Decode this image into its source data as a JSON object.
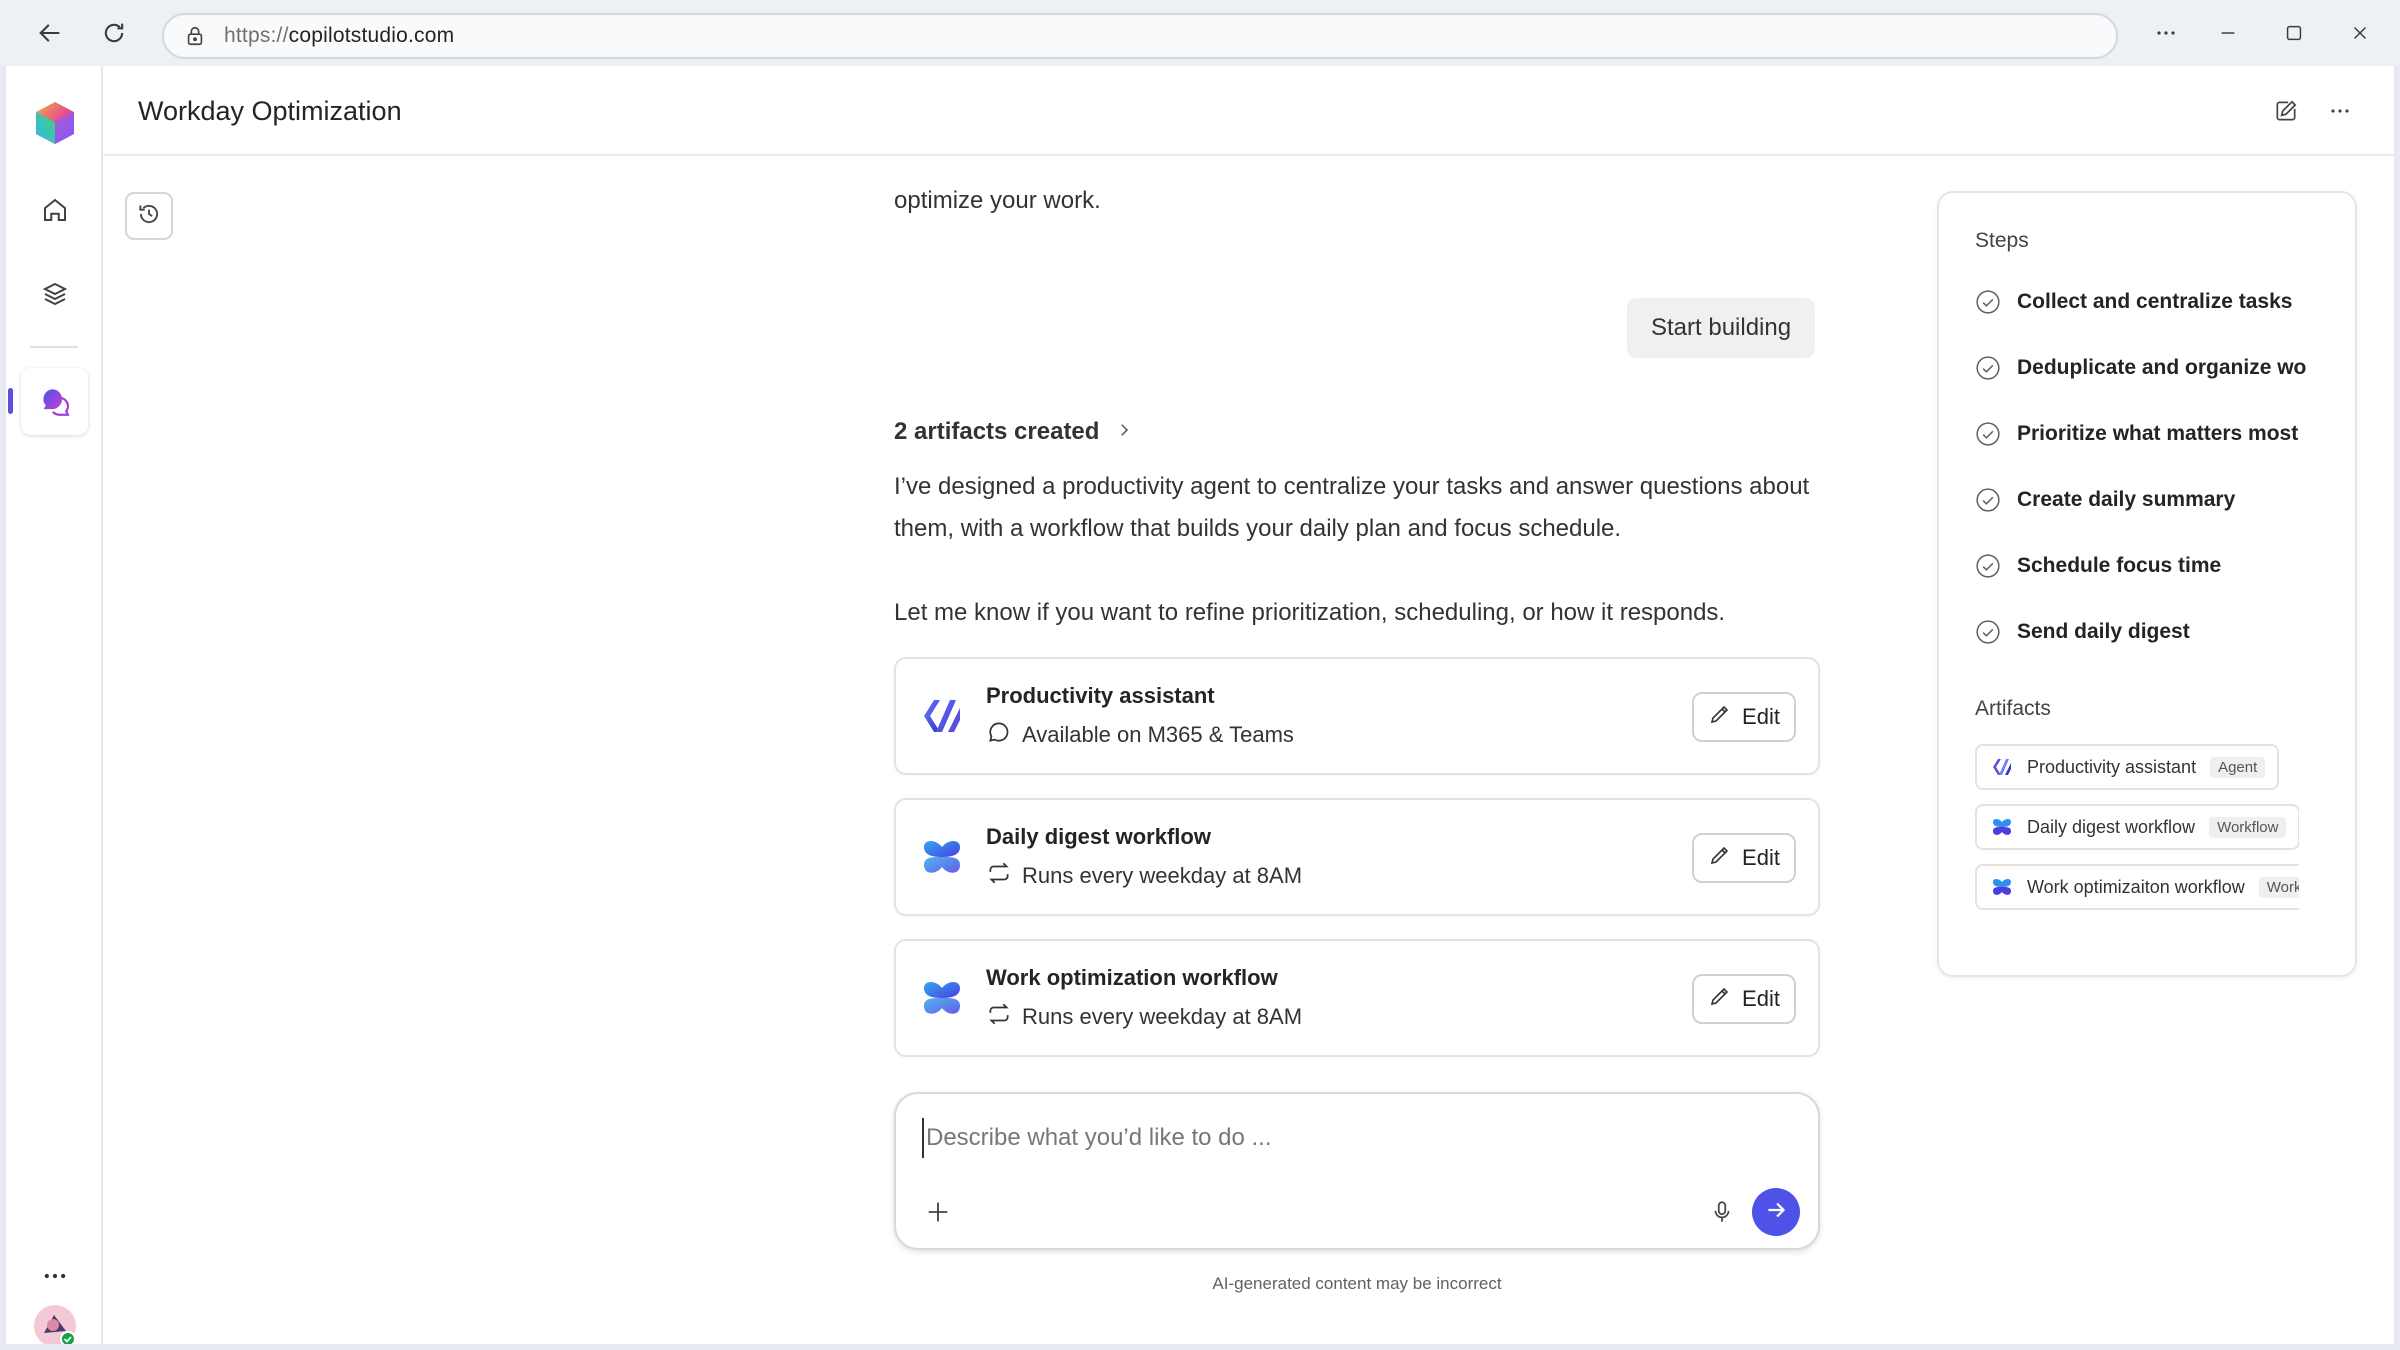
{
  "browser": {
    "url_protocol": "https://",
    "url_host": "copilotstudio.com",
    "icons": [
      "back-icon",
      "refresh-icon",
      "lock-icon",
      "more-icon",
      "minimize-icon",
      "maximize-icon",
      "close-icon"
    ]
  },
  "header": {
    "title": "Workday Optimization"
  },
  "conversation": {
    "previous_text": "optimize your work.",
    "user_message": "Start building",
    "artifacts_link": "2 artifacts created",
    "reply_paragraphs": [
      "I’ve designed a productivity agent to centralize your tasks and answer questions about them, with a workflow that builds your daily plan and focus schedule.",
      "Let me know if you want to refine prioritization, scheduling, or how it responds."
    ],
    "cards": [
      {
        "title": "Productivity assistant",
        "subtitle": "Available on M365 & Teams",
        "edit_label": "Edit"
      },
      {
        "title": "Daily digest workflow",
        "subtitle": "Runs every weekday at 8AM",
        "edit_label": "Edit"
      },
      {
        "title": "Work optimization workflow",
        "subtitle": "Runs every weekday at 8AM",
        "edit_label": "Edit"
      }
    ]
  },
  "composer": {
    "placeholder": "Describe what you’d like to do ...",
    "value": ""
  },
  "disclaimer": "AI-generated content may be incorrect",
  "panel": {
    "steps_heading": "Steps",
    "steps": [
      "Collect and centralize tasks",
      "Deduplicate and organize wo",
      "Prioritize what matters most",
      "Create daily summary",
      "Schedule focus time",
      "Send daily digest"
    ],
    "artifacts_heading": "Artifacts",
    "artifacts": [
      {
        "name": "Productivity assistant",
        "tag": "Agent"
      },
      {
        "name": "Daily digest workflow",
        "tag": "Workflow"
      },
      {
        "name": "Work optimizaiton workflow",
        "tag": "Workflow"
      }
    ]
  },
  "colors": {
    "accent": "#4f52e8",
    "rail_indicator": "#5b4fe0"
  }
}
